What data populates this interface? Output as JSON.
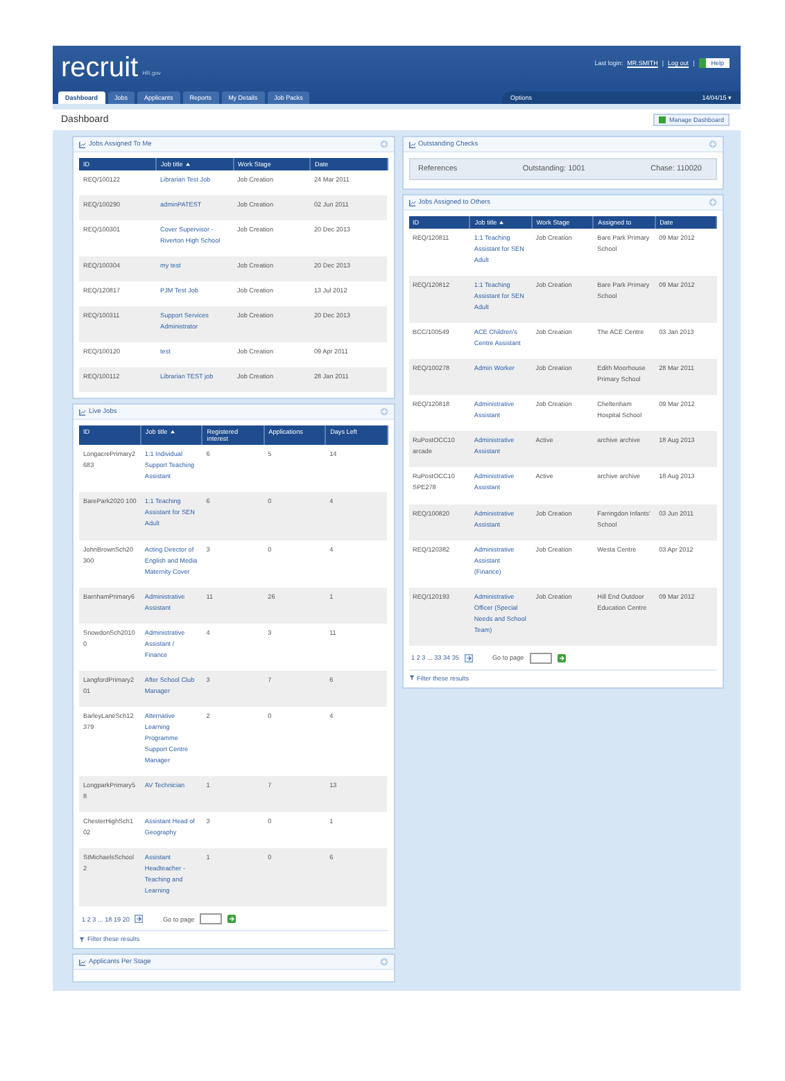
{
  "header": {
    "logo": "recruit",
    "logo_suffix": "HR.gov",
    "login_label": "Last login:",
    "user_link": "MR.SMITH",
    "logout_link": "Log out",
    "separator": "|",
    "help_button": "Help"
  },
  "tabs": [
    {
      "label": "Dashboard",
      "selected": true
    },
    {
      "label": "Jobs",
      "selected": false
    },
    {
      "label": "Applicants",
      "selected": false
    },
    {
      "label": "Reports",
      "selected": false
    },
    {
      "label": "My Details",
      "selected": false
    },
    {
      "label": "Job Packs",
      "selected": false
    }
  ],
  "nav_right": {
    "options": "Options",
    "date": "14/04/15 ▾"
  },
  "page_title": "Dashboard",
  "manage_button": "Manage Dashboard",
  "left": [
    {
      "kind": "table",
      "title": "Jobs Assigned To Me",
      "columns": [
        {
          "label": "ID",
          "sorted": false
        },
        {
          "label": "Job title",
          "sorted": true
        },
        {
          "label": "Work Stage",
          "sorted": false
        },
        {
          "label": "Date",
          "sorted": false
        }
      ],
      "rows": [
        [
          "REQ/100122",
          "Librarian Test Job",
          "Job Creation",
          "24 Mar 2011"
        ],
        [
          "REQ/100290",
          "adminPATEST",
          "Job Creation",
          "02 Jun 2011"
        ],
        [
          "REQ/100301",
          "Cover Supervisor - Riverton High School",
          "Job Creation",
          "20 Dec 2013"
        ],
        [
          "REQ/100304",
          "my test",
          "Job Creation",
          "20 Dec 2013"
        ],
        [
          "REQ/120817",
          "PJM Test Job",
          "Job Creation",
          "13 Jul 2012"
        ],
        [
          "REQ/100311",
          "Support Services Administrator",
          "Job Creation",
          "20 Dec 2013"
        ],
        [
          "REQ/100120",
          "test",
          "Job Creation",
          "09 Apr 2011"
        ],
        [
          "REQ/100112",
          "Librarian TEST job",
          "Job Creation",
          "28 Jan 2011"
        ]
      ]
    },
    {
      "kind": "table",
      "title": "Live Jobs",
      "columns": [
        {
          "label": "ID",
          "sorted": false
        },
        {
          "label": "Job title",
          "sorted": true
        },
        {
          "label": "Registered interest",
          "sorted": false
        },
        {
          "label": "Applications",
          "sorted": false
        },
        {
          "label": "Days Left",
          "sorted": false
        }
      ],
      "rows": [
        [
          "LongacrePrimary2683",
          "1:1 Individual Support Teaching Assistant",
          "6",
          "5",
          "14"
        ],
        [
          "BarePark2020 100",
          "1:1 Teaching Assistant for SEN Adult",
          "6",
          "0",
          "4"
        ],
        [
          "JohnBrownSch20300",
          "Acting Director of English and Media Maternity Cover",
          "3",
          "0",
          "4"
        ],
        [
          "BarnhamPrimary6",
          "Administrative Assistant",
          "11",
          "26",
          "1"
        ],
        [
          "SnowdonSch20100",
          "Administrative Assistant / Finance",
          "4",
          "3",
          "11"
        ],
        [
          "LangfordPrimary201",
          "After School Club Manager",
          "3",
          "7",
          "6"
        ],
        [
          "BarleyLaneSch12379",
          "Alternative Learning Programme Support Centre Manager",
          "2",
          "0",
          "4"
        ],
        [
          "LongparkPrimary58",
          "AV Technician",
          "1",
          "7",
          "13"
        ],
        [
          "ChesterHighSch102",
          "Assistant Head of Geography",
          "3",
          "0",
          "1"
        ],
        [
          "StMichaelsSchool2",
          "Assistant Headteacher - Teaching and Learning",
          "1",
          "0",
          "6"
        ]
      ],
      "pager": {
        "pages": "1 2 3 ... 18 19 20",
        "goto": "Go to page"
      },
      "filter": "Filter these results"
    },
    {
      "kind": "collapsed",
      "title": "Applicants Per Stage"
    }
  ],
  "right": [
    {
      "kind": "checks",
      "title": "Outstanding Checks",
      "label": "References",
      "outstanding": "Outstanding: 1001",
      "chase": "Chase: 110020"
    },
    {
      "kind": "table",
      "title": "Jobs Assigned to Others",
      "columns": [
        {
          "label": "ID",
          "sorted": false
        },
        {
          "label": "Job title",
          "sorted": true
        },
        {
          "label": "Work Stage",
          "sorted": false
        },
        {
          "label": "Assigned to",
          "sorted": false
        },
        {
          "label": "Date",
          "sorted": false
        }
      ],
      "rows": [
        [
          "REQ/120811",
          "1:1 Teaching Assistant for SEN Adult",
          "Job Creation",
          "Bare Park Primary School",
          "09 Mar 2012"
        ],
        [
          "REQ/120812",
          "1:1 Teaching Assistant for SEN Adult",
          "Job Creation",
          "Bare Park Primary School",
          "09 Mar 2012"
        ],
        [
          "BCC/100549",
          "ACE Children's Centre Assistant",
          "Job Creation",
          "The ACE Centre",
          "03 Jan 2013"
        ],
        [
          "REQ/100278",
          "Admin Worker",
          "Job Creation",
          "Edith Moorhouse Primary School",
          "28 Mar 2011"
        ],
        [
          "REQ/120818",
          "Administrative Assistant",
          "Job Creation",
          "Cheltenham Hospital School",
          "09 Mar 2012"
        ],
        [
          "RuPostOCC10 arcade",
          "Administrative Assistant",
          "Active",
          "archive archive",
          "18 Aug 2013"
        ],
        [
          "RuPostOCC10 SPE278",
          "Administrative Assistant",
          "Active",
          "archive archive",
          "18 Aug 2013"
        ],
        [
          "REQ/100820",
          "Administrative Assistant",
          "Job Creation",
          "Farringdon Infants' School",
          "03 Jun 2011"
        ],
        [
          "REQ/120382",
          "Administrative Assistant (Finance)",
          "Job Creation",
          "Westa Centre",
          "03 Apr 2012"
        ],
        [
          "REQ/120193",
          "Administrative Officer (Special Needs and School Team)",
          "Job Creation",
          "Hill End Outdoor Education Centre",
          "09 Mar 2012"
        ]
      ],
      "pager": {
        "pages": "1 2 3 ... 33 34 35",
        "goto": "Go to page"
      },
      "filter": "Filter these results"
    }
  ]
}
